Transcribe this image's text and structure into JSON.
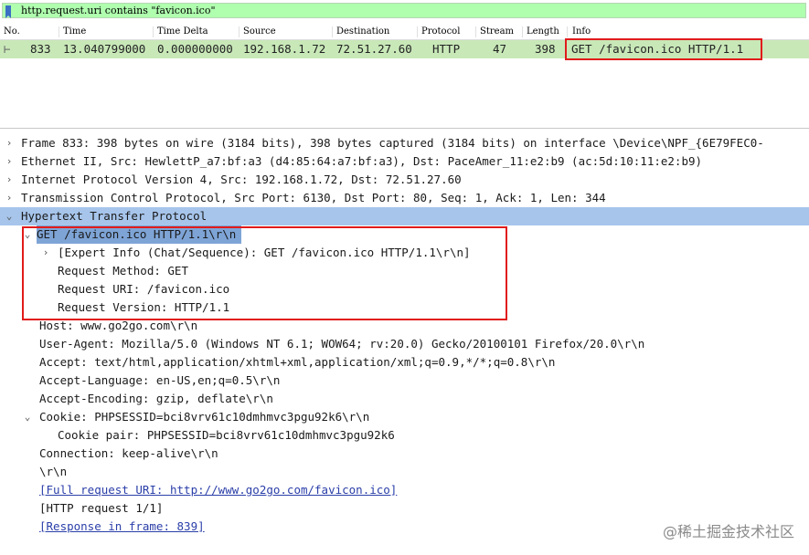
{
  "filter": {
    "text": "http.request.uri contains \"favicon.ico\""
  },
  "packet_list": {
    "columns": [
      "No.",
      "Time",
      "Time Delta",
      "Source",
      "Destination",
      "Protocol",
      "Stream",
      "Length",
      "Info"
    ],
    "rows": [
      {
        "no": "833",
        "time": "13.040799000",
        "delta": "0.000000000",
        "source": "192.168.1.72",
        "destination": "72.51.27.60",
        "protocol": "HTTP",
        "stream": "47",
        "length": "398",
        "info": "GET /favicon.ico HTTP/1.1"
      }
    ]
  },
  "details": {
    "frame": "Frame 833: 398 bytes on wire (3184 bits), 398 bytes captured (3184 bits) on interface \\Device\\NPF_{6E79FEC0-",
    "ethernet": "Ethernet II, Src: HewlettP_a7:bf:a3 (d4:85:64:a7:bf:a3), Dst: PaceAmer_11:e2:b9 (ac:5d:10:11:e2:b9)",
    "ip": "Internet Protocol Version 4, Src: 192.168.1.72, Dst: 72.51.27.60",
    "tcp": "Transmission Control Protocol, Src Port: 6130, Dst Port: 80, Seq: 1, Ack: 1, Len: 344",
    "http": "Hypertext Transfer Protocol",
    "request_line": "GET /favicon.ico HTTP/1.1\\r\\n",
    "expert_info": "[Expert Info (Chat/Sequence): GET /favicon.ico HTTP/1.1\\r\\n]",
    "request_method": "Request Method: GET",
    "request_uri": "Request URI: /favicon.ico",
    "request_version": "Request Version: HTTP/1.1",
    "host": "Host: www.go2go.com\\r\\n",
    "user_agent": "User-Agent: Mozilla/5.0 (Windows NT 6.1; WOW64; rv:20.0) Gecko/20100101 Firefox/20.0\\r\\n",
    "accept": "Accept: text/html,application/xhtml+xml,application/xml;q=0.9,*/*;q=0.8\\r\\n",
    "accept_language": "Accept-Language: en-US,en;q=0.5\\r\\n",
    "accept_encoding": "Accept-Encoding: gzip, deflate\\r\\n",
    "cookie": "Cookie: PHPSESSID=bci8vrv61c10dmhmvc3pgu92k6\\r\\n",
    "cookie_pair": "Cookie pair: PHPSESSID=bci8vrv61c10dmhmvc3pgu92k6",
    "connection": "Connection: keep-alive\\r\\n",
    "crlf": "\\r\\n",
    "full_uri": "[Full request URI: http://www.go2go.com/favicon.ico]",
    "http_request": "[HTTP request 1/1]",
    "response_in": "[Response in frame: 839]"
  },
  "watermark": "@稀土掘金技术社区",
  "colors": {
    "filter_ok": "#afffaf",
    "row_http": "#c8e8b8",
    "selected": "#7ea4d6",
    "highlight": "#e11b1b",
    "link": "#2a3ea8"
  },
  "icons": {
    "expanded": "chevron-down-icon",
    "collapsed": "chevron-right-icon"
  }
}
